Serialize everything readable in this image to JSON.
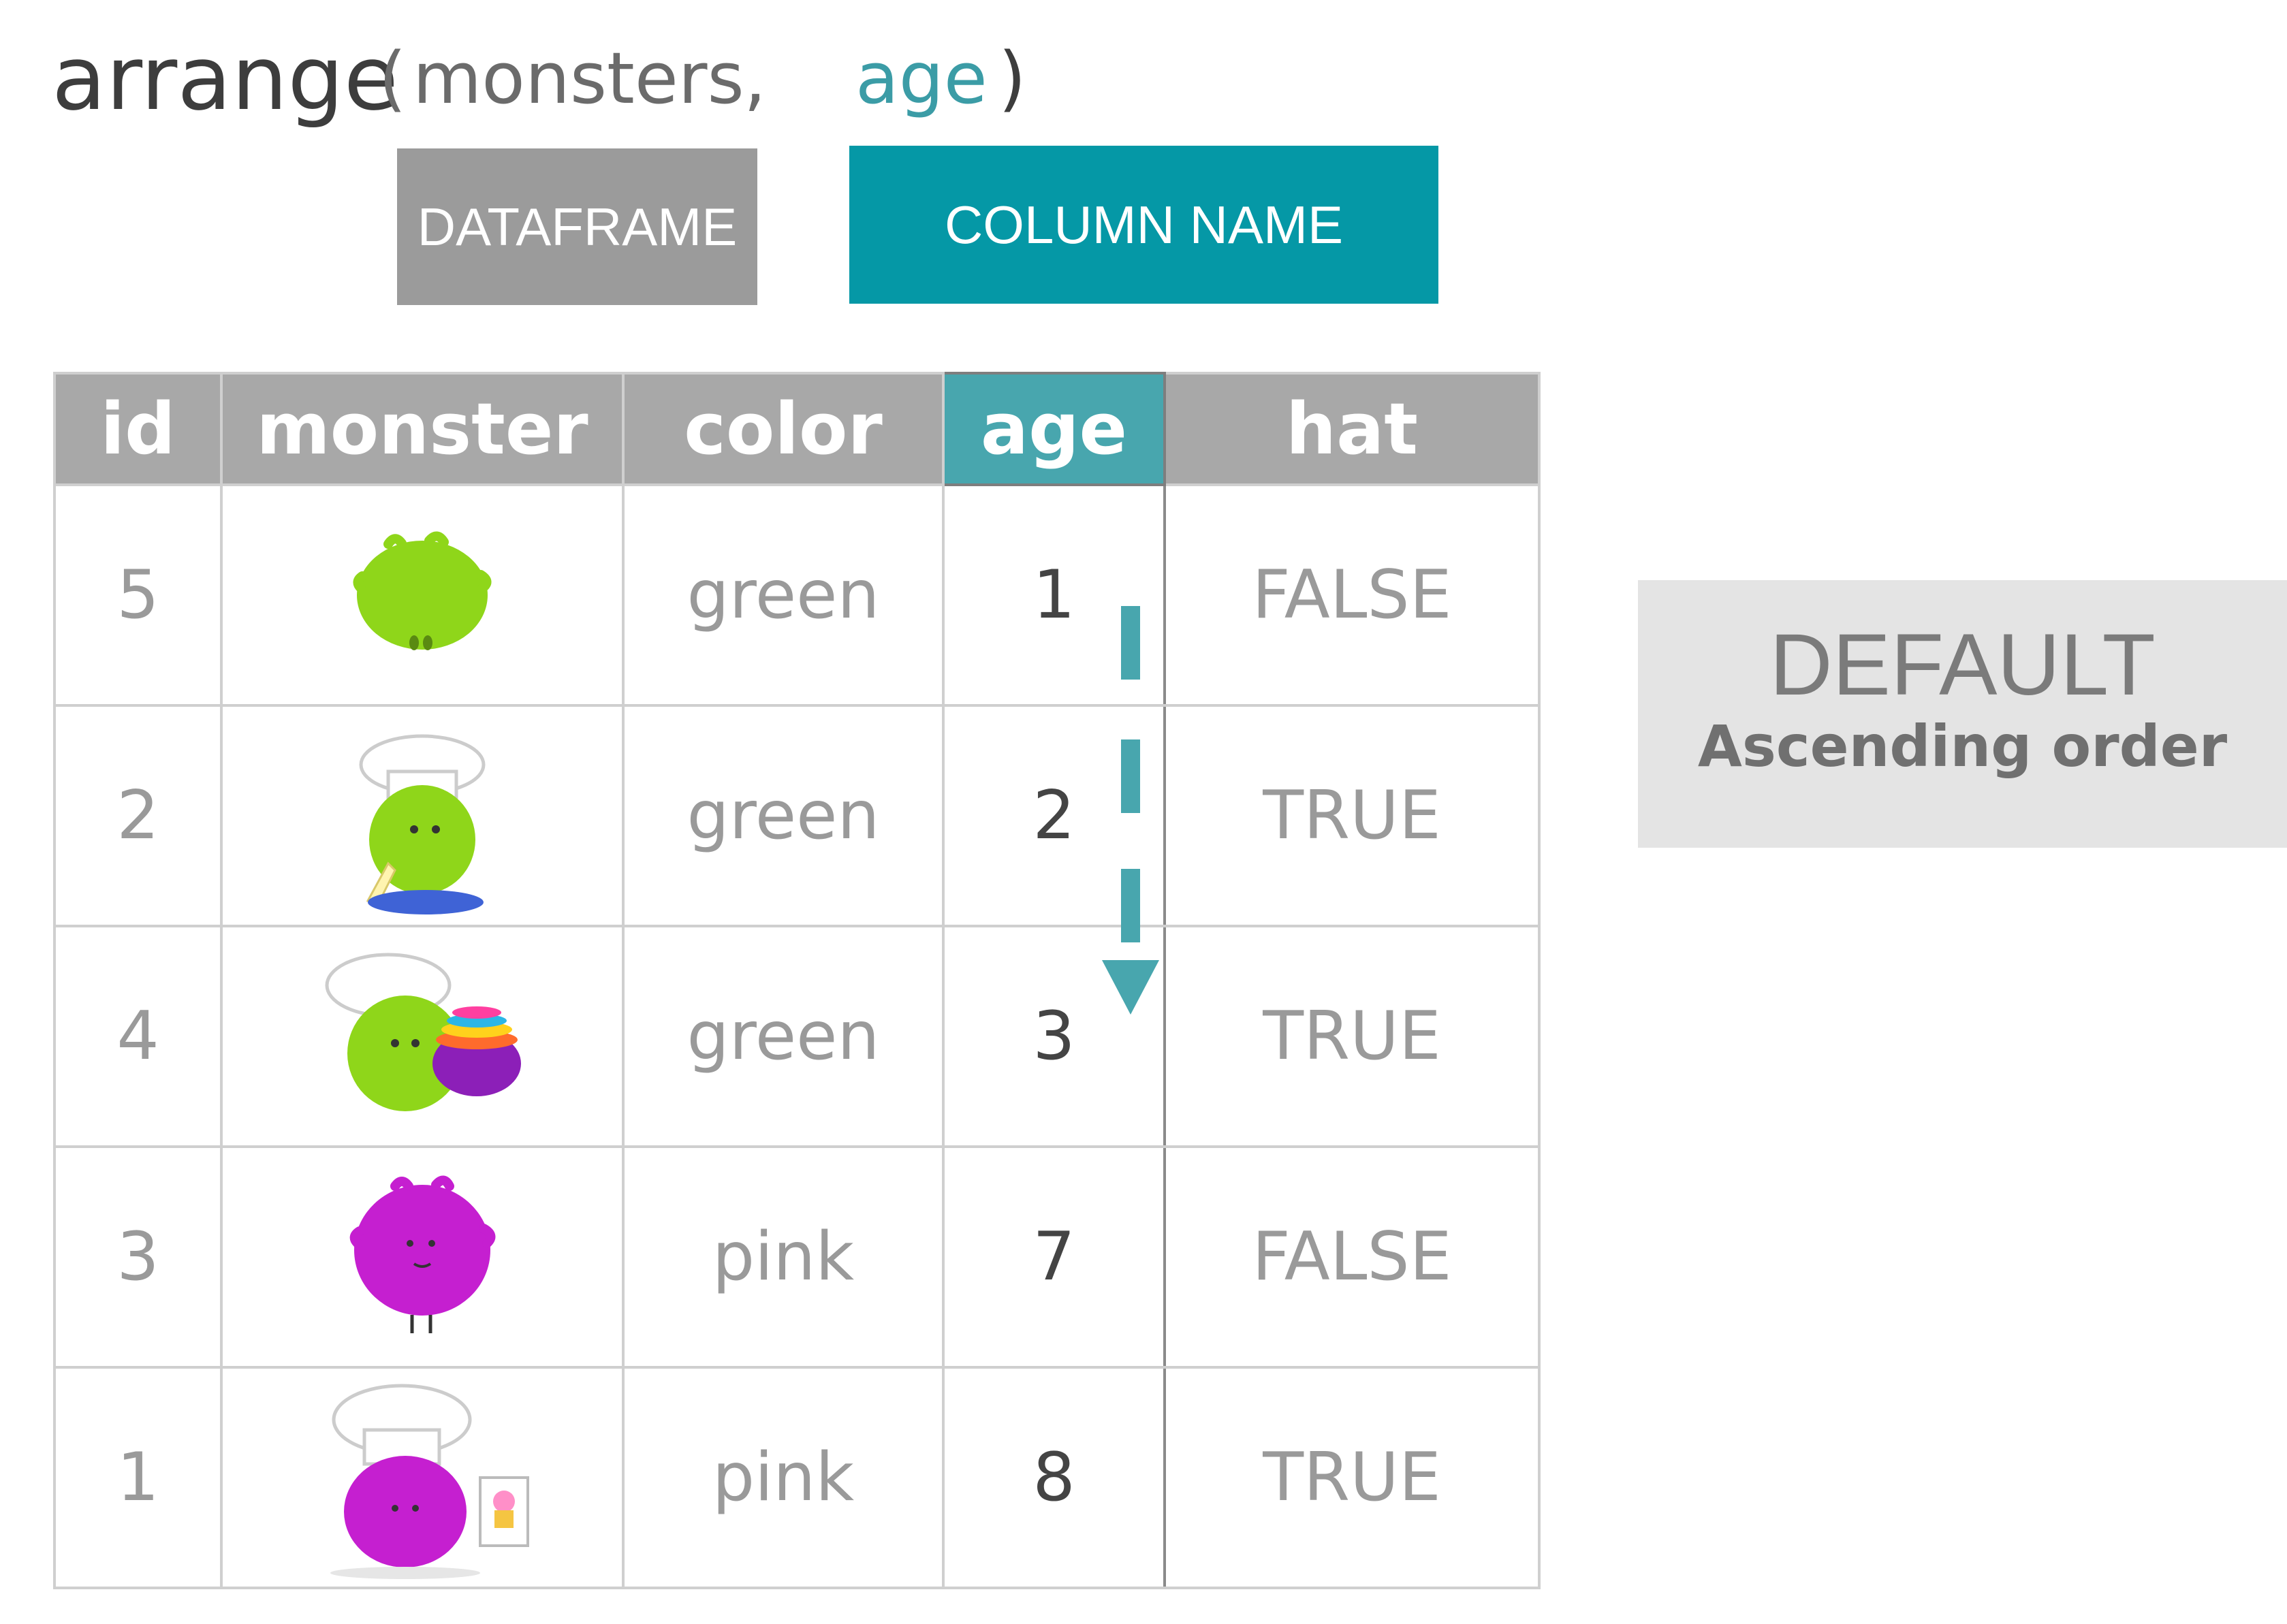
{
  "code": {
    "function": "arrange",
    "open_paren": "(",
    "dataframe_arg": "monsters",
    "comma": ",",
    "column_arg": "age",
    "close_paren": ")"
  },
  "labels": {
    "dataframe": "DATAFRAME",
    "column_name": "COLUMN NAME"
  },
  "table": {
    "columns": [
      "id",
      "monster",
      "color",
      "age",
      "hat"
    ],
    "rows": [
      {
        "id": "5",
        "monster": "green monster",
        "color": "green",
        "age": "1",
        "hat": "FALSE"
      },
      {
        "id": "2",
        "monster": "green monster with chef hat and piping bag",
        "color": "green",
        "age": "2",
        "hat": "TRUE"
      },
      {
        "id": "4",
        "monster": "green monster with chef hat and mixing bowls",
        "color": "green",
        "age": "3",
        "hat": "TRUE"
      },
      {
        "id": "3",
        "monster": "pink monster",
        "color": "pink",
        "age": "7",
        "hat": "FALSE"
      },
      {
        "id": "1",
        "monster": "pink monster with chef hat and cupcake recipe",
        "color": "pink",
        "age": "8",
        "hat": "TRUE"
      }
    ]
  },
  "note": {
    "title": "DEFAULT",
    "subtitle": "Ascending order"
  },
  "colors": {
    "accent": "#0598a6",
    "highlight_header": "#48a6ae",
    "header_gray": "#a8a8a8",
    "green_monster": "#8fd61a",
    "pink_monster": "#c51fd0"
  }
}
